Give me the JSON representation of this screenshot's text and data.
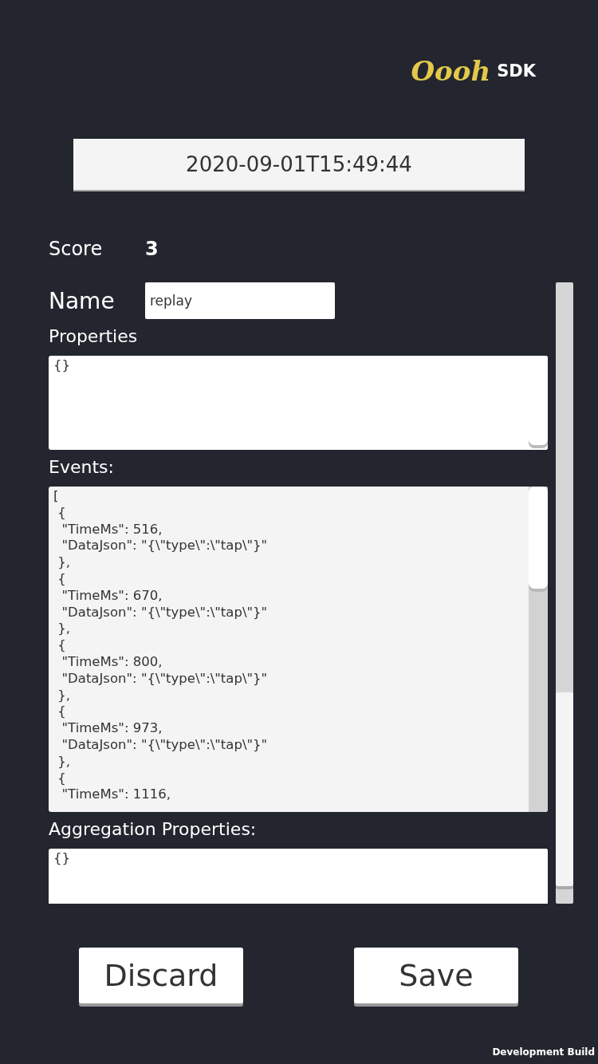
{
  "logo": {
    "mark": "Oooh",
    "text": "SDK"
  },
  "timestamp": "2020-09-01T15:49:44",
  "score": {
    "label": "Score",
    "value": "3"
  },
  "name": {
    "label": "Name",
    "value": "replay"
  },
  "properties": {
    "label": "Properties",
    "value": "{}"
  },
  "events": {
    "label": "Events:",
    "value": "[\n {\n  \"TimeMs\": 516,\n  \"DataJson\": \"{\\\"type\\\":\\\"tap\\\"}\"\n },\n {\n  \"TimeMs\": 670,\n  \"DataJson\": \"{\\\"type\\\":\\\"tap\\\"}\"\n },\n {\n  \"TimeMs\": 800,\n  \"DataJson\": \"{\\\"type\\\":\\\"tap\\\"}\"\n },\n {\n  \"TimeMs\": 973,\n  \"DataJson\": \"{\\\"type\\\":\\\"tap\\\"}\"\n },\n {\n  \"TimeMs\": 1116,"
  },
  "aggregation": {
    "label": "Aggregation Properties:",
    "value": "{}"
  },
  "buttons": [
    "Discard",
    "Save"
  ],
  "footer": "Development Build"
}
